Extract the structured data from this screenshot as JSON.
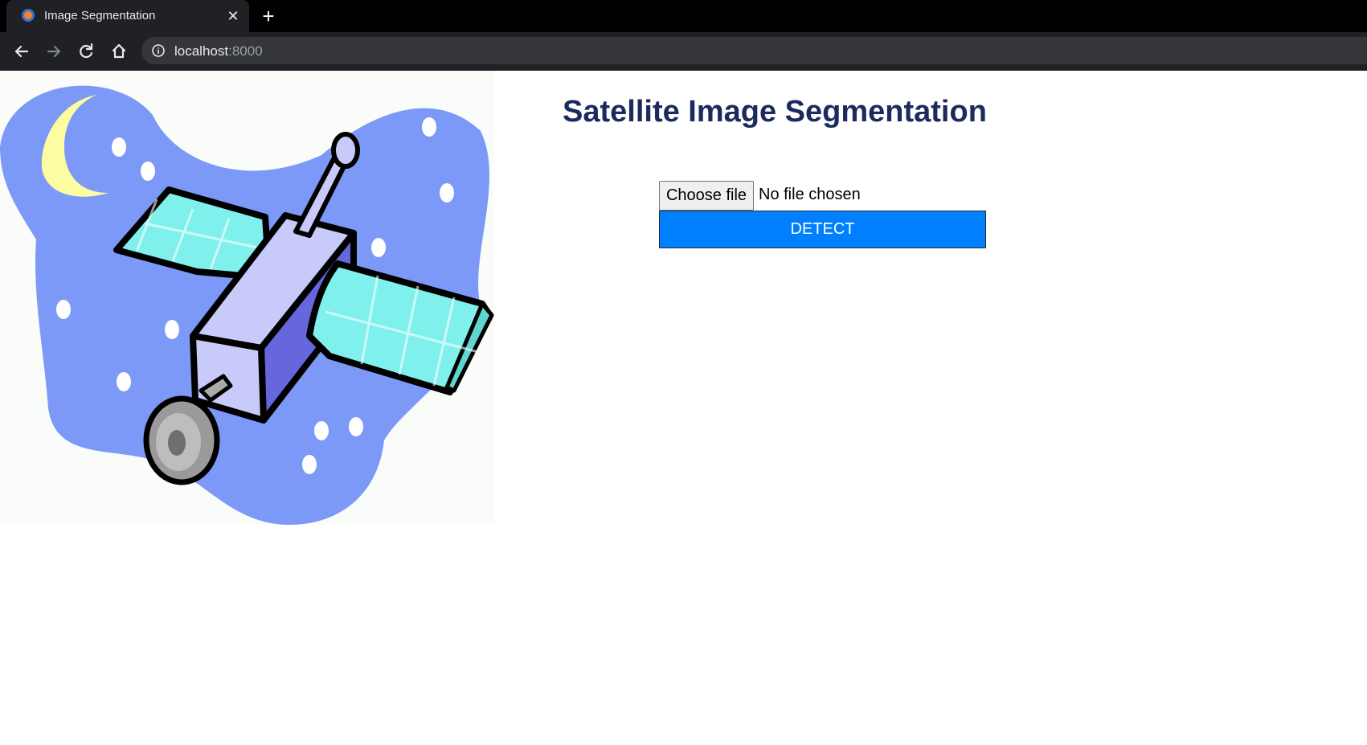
{
  "browser": {
    "tab": {
      "title": "Image Segmentation",
      "favicon": "firefox-logo-icon",
      "close_icon": "close-icon"
    },
    "new_tab_icon": "plus-icon",
    "nav": {
      "back_icon": "arrow-left-icon",
      "forward_icon": "arrow-right-icon",
      "reload_icon": "reload-icon",
      "home_icon": "home-icon"
    },
    "address": {
      "info_icon": "info-icon",
      "host": "localhost",
      "port": ":8000"
    }
  },
  "page": {
    "hero_image": "satellite-illustration",
    "title": "Satellite Image Segmentation",
    "upload": {
      "button_label": "Choose file",
      "status": "No file chosen"
    },
    "detect_label": "DETECT",
    "colors": {
      "title": "#1c2a5e",
      "detect_button": "#0080ff"
    }
  }
}
